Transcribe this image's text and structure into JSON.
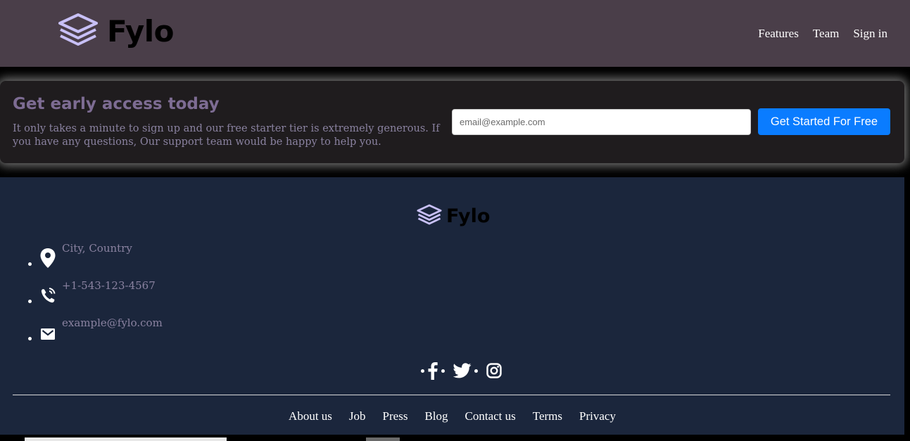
{
  "header": {
    "brand": "Fylo",
    "nav": [
      "Features",
      "Team",
      "Sign in"
    ]
  },
  "cta": {
    "title": "Get early access today",
    "text": "It only takes a minute to sign up and our free starter tier is extremely generous. If you have any questions, Our support team would be happy to help you.",
    "email_placeholder": "email@example.com",
    "button_label": "Get Started For Free"
  },
  "footer": {
    "brand": "Fylo",
    "contacts": [
      {
        "icon": "location-pin-icon",
        "text": "City, Country"
      },
      {
        "icon": "phone-icon",
        "text": "+1-543-123-4567"
      },
      {
        "icon": "mail-icon",
        "text": "example@fylo.com"
      }
    ],
    "social": [
      "facebook-icon",
      "twitter-icon",
      "instagram-icon"
    ],
    "links": [
      "About us",
      "Job",
      "Press",
      "Blog",
      "Contact us",
      "Terms",
      "Privacy"
    ]
  },
  "colors": {
    "header_bg": "#4a3e49",
    "cta_bg": "#1f1c1e",
    "footer_bg": "#1b263c",
    "accent_blue": "#0a7cff",
    "muted_text": "#8a82a0",
    "logo_lavender": "#c8c0f6"
  }
}
